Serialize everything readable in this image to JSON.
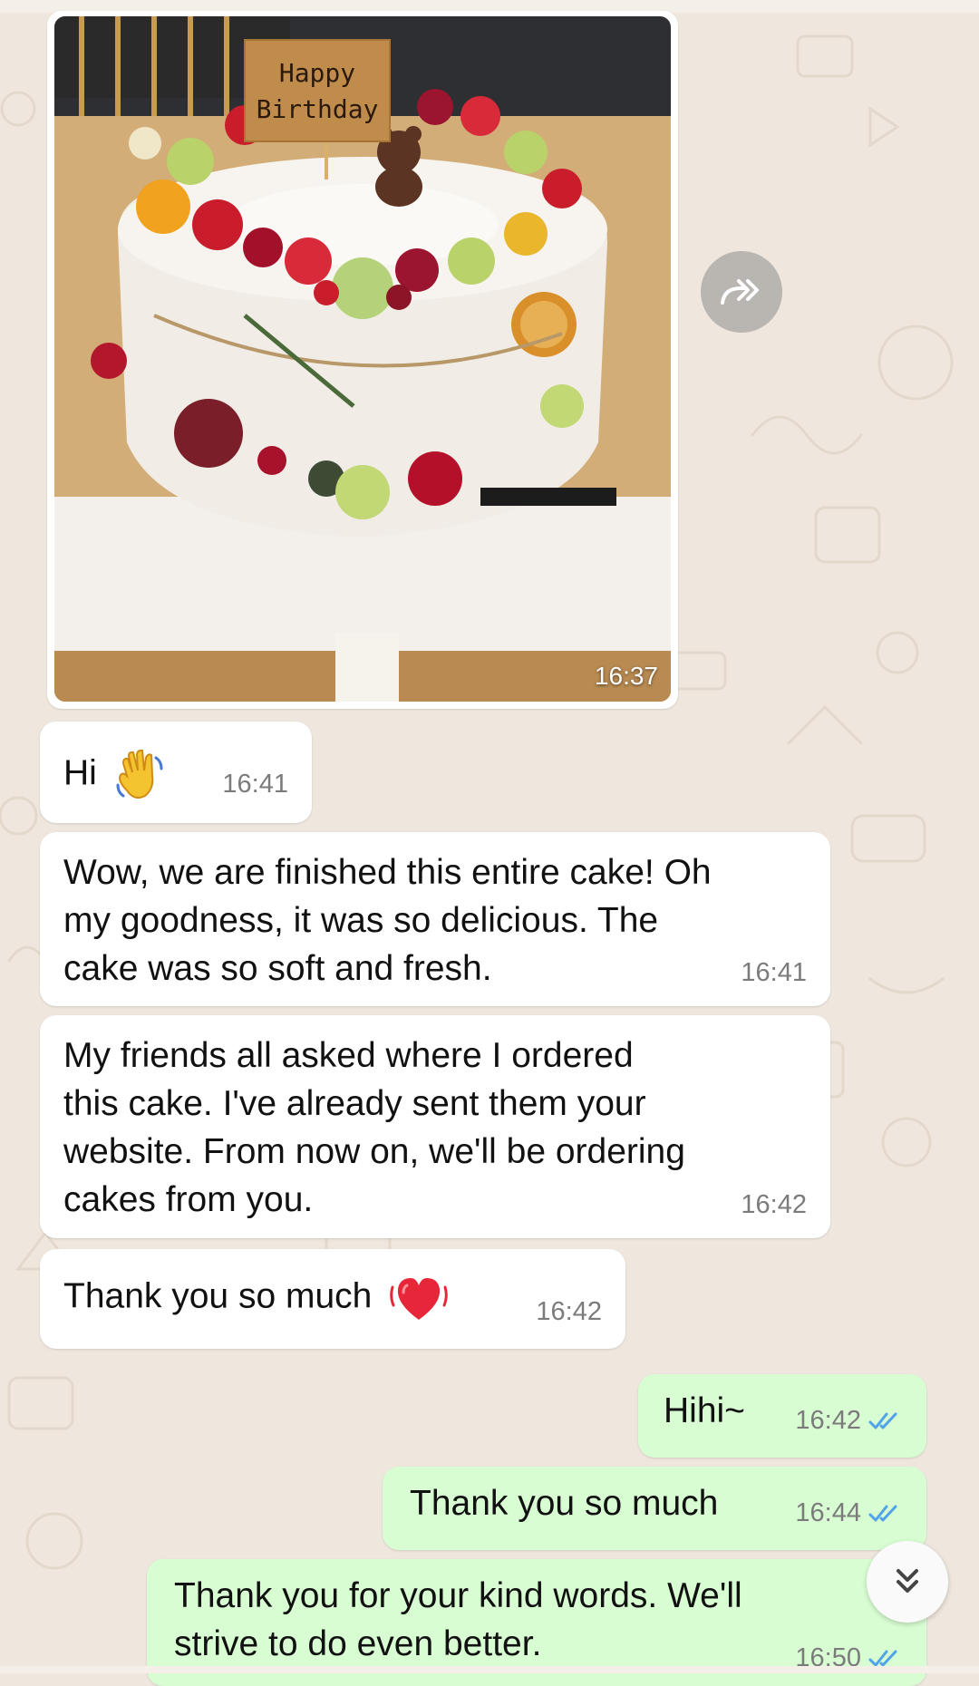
{
  "chat": {
    "image_message": {
      "time": "16:37",
      "sign_text_1": "Happy",
      "sign_text_2": "Birthday"
    },
    "messages": [
      {
        "direction": "in",
        "lines": [
          "Hi"
        ],
        "emoji": "waving-hand",
        "time": "16:41"
      },
      {
        "direction": "in",
        "lines": [
          "Wow, we are finished this entire cake! Oh",
          "my goodness, it was so delicious. The",
          "cake was so soft and fresh."
        ],
        "time": "16:41"
      },
      {
        "direction": "in",
        "lines": [
          "My friends all asked where I ordered",
          "this cake. I've already sent them your",
          "website. From now on, we'll be ordering",
          "cakes from you."
        ],
        "time": "16:42"
      },
      {
        "direction": "in",
        "lines": [
          "Thank you so much"
        ],
        "emoji": "beating-heart",
        "time": "16:42"
      },
      {
        "direction": "out",
        "lines": [
          "Hihi~"
        ],
        "time": "16:42",
        "status": "read"
      },
      {
        "direction": "out",
        "lines": [
          "Thank you so much"
        ],
        "time": "16:44",
        "status": "read"
      },
      {
        "direction": "out",
        "lines": [
          "Thank you for your kind words. We'll",
          "strive to do even better."
        ],
        "time": "16:50",
        "status": "read"
      }
    ]
  },
  "colors": {
    "background": "#efe7de",
    "incoming": "#ffffff",
    "outgoing": "#d9fdd3",
    "read_ticks": "#4fa3e8"
  },
  "icons": {
    "forward": "forward-icon",
    "scroll_down": "double-chevron-down-icon",
    "read_receipt": "double-check-icon"
  }
}
